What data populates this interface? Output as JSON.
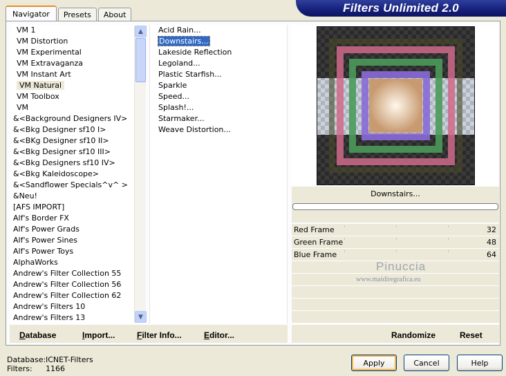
{
  "tabs": [
    "Navigator",
    "Presets",
    "About"
  ],
  "title": "Filters Unlimited 2.0",
  "categories": [
    "VM 1",
    "VM Distortion",
    "VM Experimental",
    "VM Extravaganza",
    "VM Instant Art",
    "VM Natural",
    "VM Toolbox",
    "VM",
    "&<Background Designers IV>",
    "&<Bkg Designer sf10 I>",
    "&<BKg Designer sf10 II>",
    "&<Bkg Designer sf10 III>",
    "&<Bkg Designers sf10 IV>",
    "&<Bkg Kaleidoscope>",
    "&<Sandflower Specials^v^ >",
    "&Neu!",
    "[AFS IMPORT]",
    "Alf's Border FX",
    "Alf's Power Grads",
    "Alf's Power Sines",
    "Alf's Power Toys",
    "AlphaWorks",
    "Andrew's Filter Collection 55",
    "Andrew's Filter Collection 56",
    "Andrew's Filter Collection 62",
    "Andrew's Filters 10",
    "Andrew's Filters 13"
  ],
  "selected_category": "VM Natural",
  "filters": [
    "Acid Rain...",
    "Downstairs...",
    "Lakeside Reflection",
    "Legoland...",
    "Plastic Starfish...",
    "Sparkle",
    "Speed...",
    "Splash!...",
    "Starmaker...",
    "Weave Distortion..."
  ],
  "selected_filter": "Downstairs...",
  "filter_name": "Downstairs...",
  "params": [
    {
      "label": "Red Frame",
      "value": "32"
    },
    {
      "label": "Green Frame",
      "value": "48"
    },
    {
      "label": "Blue Frame",
      "value": "64"
    }
  ],
  "watermark": {
    "line1": "Pinuccia",
    "line2": "www.maidiregrafica.eu"
  },
  "left_buttons": [
    {
      "label": "Database",
      "ul": "D"
    },
    {
      "label": "Import...",
      "ul": "I"
    },
    {
      "label": "Filter Info...",
      "ul": "F"
    },
    {
      "label": "Editor...",
      "ul": "E"
    }
  ],
  "right_buttons": [
    "Randomize",
    "Reset"
  ],
  "status": {
    "database_label": "Database:",
    "database_value": "ICNET-Filters",
    "filters_label": "Filters:",
    "filters_value": "1166"
  },
  "dialog_buttons": {
    "apply": "Apply",
    "cancel": "Cancel",
    "help": "Help"
  },
  "colors": {
    "title_bar": "#16207a",
    "selection": "#316ac5",
    "frame_red": "#d06a8a",
    "frame_green": "#4a9a5a",
    "frame_blue": "#8a6ad8"
  }
}
